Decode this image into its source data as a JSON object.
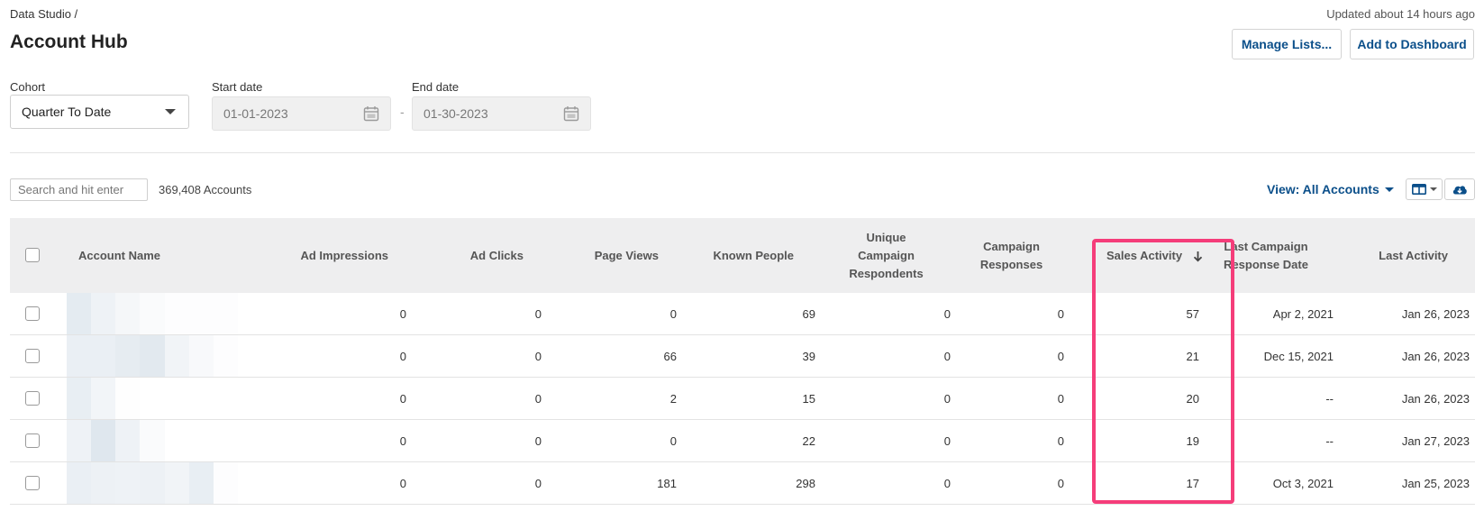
{
  "header": {
    "breadcrumb": "Data Studio /",
    "title": "Account Hub",
    "updated": "Updated about 14 hours ago",
    "manage_lists": "Manage Lists...",
    "add_dashboard": "Add to Dashboard"
  },
  "filters": {
    "cohort_label": "Cohort",
    "cohort_value": "Quarter To Date",
    "start_label": "Start date",
    "start_value": "01-01-2023",
    "end_label": "End date",
    "end_value": "01-30-2023",
    "separator": "-"
  },
  "toolbar": {
    "search_placeholder": "Search and hit enter",
    "count": "369,408 Accounts",
    "view": "View: All Accounts",
    "columns_icon": "columns-icon",
    "download_icon": "cloud-download-icon"
  },
  "table": {
    "columns": {
      "account_name": "Account Name",
      "ad_impressions": "Ad Impressions",
      "ad_clicks": "Ad Clicks",
      "page_views": "Page Views",
      "known_people": "Known People",
      "unique_1": "Unique",
      "unique_2": "Campaign",
      "unique_3": "Respondents",
      "campaign_responses_1": "Campaign",
      "campaign_responses_2": "Responses",
      "sales_activity": "Sales Activity",
      "last_campaign_1": "Last Campaign",
      "last_campaign_2": "Response Date",
      "last_activity": "Last Activity"
    },
    "sort_icon": "arrow-down-icon",
    "rows": [
      {
        "ad_impressions": "0",
        "ad_clicks": "0",
        "page_views": "0",
        "known_people": "69",
        "unique": "0",
        "campaign_responses": "0",
        "sales_activity": "57",
        "last_campaign": "Apr 2, 2021",
        "last_activity": "Jan 26, 2023"
      },
      {
        "ad_impressions": "0",
        "ad_clicks": "0",
        "page_views": "66",
        "known_people": "39",
        "unique": "0",
        "campaign_responses": "0",
        "sales_activity": "21",
        "last_campaign": "Dec 15, 2021",
        "last_activity": "Jan 26, 2023"
      },
      {
        "ad_impressions": "0",
        "ad_clicks": "0",
        "page_views": "2",
        "known_people": "15",
        "unique": "0",
        "campaign_responses": "0",
        "sales_activity": "20",
        "last_campaign": "--",
        "last_activity": "Jan 26, 2023"
      },
      {
        "ad_impressions": "0",
        "ad_clicks": "0",
        "page_views": "0",
        "known_people": "22",
        "unique": "0",
        "campaign_responses": "0",
        "sales_activity": "19",
        "last_campaign": "--",
        "last_activity": "Jan 27, 2023"
      },
      {
        "ad_impressions": "0",
        "ad_clicks": "0",
        "page_views": "181",
        "known_people": "298",
        "unique": "0",
        "campaign_responses": "0",
        "sales_activity": "17",
        "last_campaign": "Oct 3, 2021",
        "last_activity": "Jan 25, 2023"
      }
    ]
  },
  "colors": {
    "accent": "#0b4f8a",
    "highlight": "#f53d7a",
    "header_bg": "#eeeeef"
  }
}
